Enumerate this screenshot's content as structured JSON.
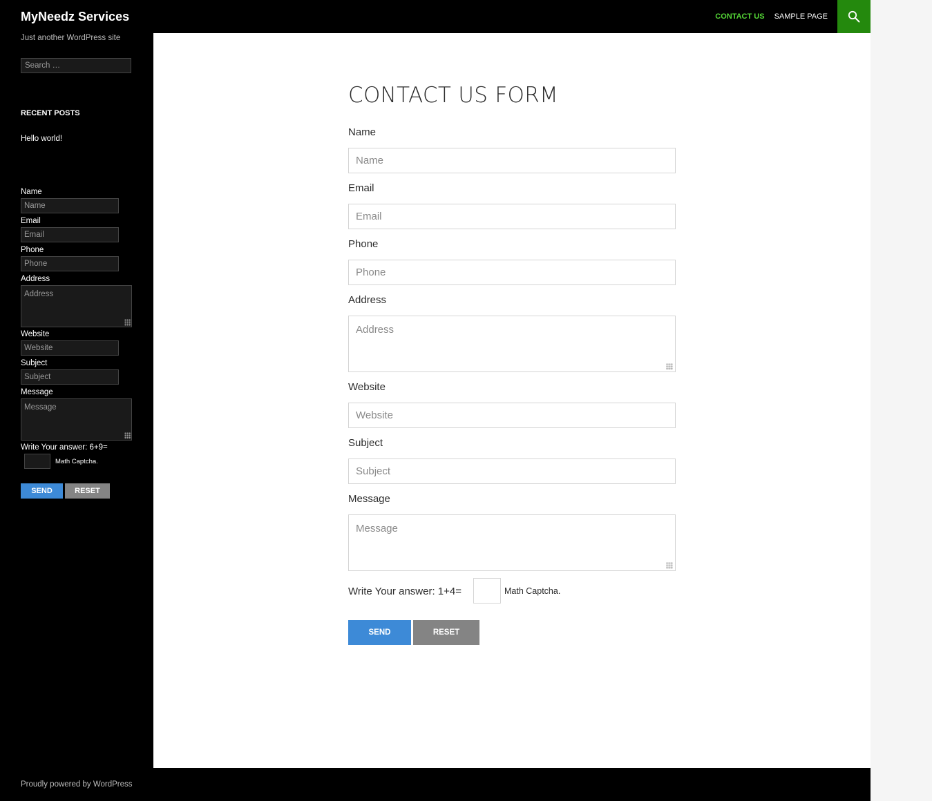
{
  "header": {
    "site_title": "MyNeedz Services",
    "nav": [
      {
        "label": "CONTACT US",
        "active": true
      },
      {
        "label": "SAMPLE PAGE",
        "active": false
      }
    ],
    "accent_color": "#24890d",
    "active_nav_color": "#55d737"
  },
  "sidebar": {
    "tagline": "Just another WordPress site",
    "search_placeholder": "Search …",
    "recent_posts_title": "RECENT POSTS",
    "recent_posts": [
      "Hello world!"
    ],
    "form": {
      "name_label": "Name",
      "name_placeholder": "Name",
      "email_label": "Email",
      "email_placeholder": "Email",
      "phone_label": "Phone",
      "phone_placeholder": "Phone",
      "address_label": "Address",
      "address_placeholder": "Address",
      "website_label": "Website",
      "website_placeholder": "Website",
      "subject_label": "Subject",
      "subject_placeholder": "Subject",
      "message_label": "Message",
      "message_placeholder": "Message",
      "captcha_question": "Write Your answer: 6+9=",
      "captcha_note": "Math Captcha.",
      "send_label": "SEND",
      "reset_label": "RESET"
    }
  },
  "main": {
    "title": "CONTACT US FORM",
    "form": {
      "name_label": "Name",
      "name_placeholder": "Name",
      "email_label": "Email",
      "email_placeholder": "Email",
      "phone_label": "Phone",
      "phone_placeholder": "Phone",
      "address_label": "Address",
      "address_placeholder": "Address",
      "website_label": "Website",
      "website_placeholder": "Website",
      "subject_label": "Subject",
      "subject_placeholder": "Subject",
      "message_label": "Message",
      "message_placeholder": "Message",
      "captcha_question": "Write Your answer: 1+4=",
      "captcha_note": "Math Captcha.",
      "send_label": "SEND",
      "reset_label": "RESET"
    },
    "send_color": "#3d8ad7",
    "reset_color": "#848484"
  },
  "footer": {
    "credit": "Proudly powered by WordPress"
  }
}
